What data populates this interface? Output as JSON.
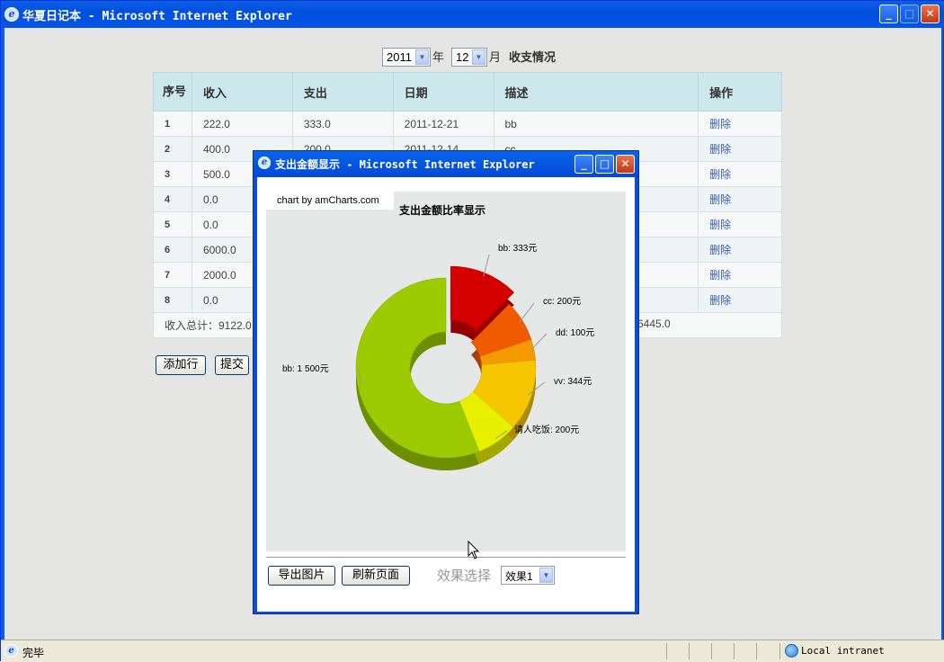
{
  "window": {
    "title": "华夏日记本 - Microsoft Internet Explorer"
  },
  "filter": {
    "year": "2011",
    "year_suffix": "年",
    "month": "12",
    "month_suffix": "月",
    "heading": "收支情况"
  },
  "table": {
    "headers": [
      "序号",
      "收入",
      "支出",
      "日期",
      "描述",
      "操作"
    ],
    "rows": [
      {
        "no": "1",
        "income": "222.0",
        "expense": "333.0",
        "date": "2011-12-21",
        "desc": "bb",
        "action": "删除"
      },
      {
        "no": "2",
        "income": "400.0",
        "expense": "200.0",
        "date": "2011-12-14",
        "desc": "cc",
        "action": "删除"
      },
      {
        "no": "3",
        "income": "500.0",
        "action": "删除"
      },
      {
        "no": "4",
        "income": "0.0",
        "action": "删除"
      },
      {
        "no": "5",
        "income": "0.0",
        "action": "删除"
      },
      {
        "no": "6",
        "income": "6000.0",
        "action": "删除"
      },
      {
        "no": "7",
        "income": "2000.0",
        "action": "删除"
      },
      {
        "no": "8",
        "income": "0.0",
        "action": "删除"
      }
    ],
    "total_income": "收入总计：9122.0",
    "total_tail": "6445.0"
  },
  "buttons": {
    "add_row": "添加行",
    "submit": "提交"
  },
  "popup": {
    "title": "支出金额显示 - Microsoft Internet Explorer",
    "credit": "chart by amCharts.com",
    "export": "导出图片",
    "refresh": "刷新页面",
    "effect_label": "效果选择",
    "effect_value": "效果1"
  },
  "chart_data": {
    "type": "pie",
    "title": "支出金额比率显示",
    "slices": [
      {
        "label": "bb: 333元",
        "value": 333,
        "color": "#d40000",
        "pulled": true
      },
      {
        "label": "cc: 200元",
        "value": 200,
        "color": "#f05a00"
      },
      {
        "label": "dd: 100元",
        "value": 100,
        "color": "#f49a00"
      },
      {
        "label": "vv: 344元",
        "value": 344,
        "color": "#f6c700"
      },
      {
        "label": "请人吃饭: 200元",
        "value": 200,
        "color": "#e8f000"
      },
      {
        "label": "bb: 1 500元",
        "value": 1500,
        "color": "#9bcb00"
      }
    ]
  },
  "status": {
    "text": "完毕",
    "zone": "Local intranet"
  }
}
